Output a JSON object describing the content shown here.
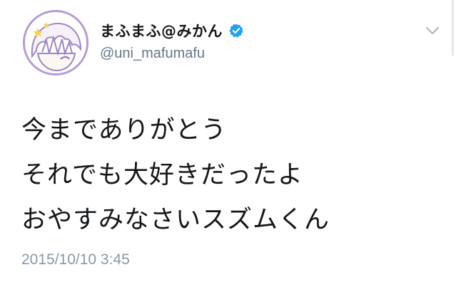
{
  "tweet": {
    "display_name": "まふまふ@みかん",
    "handle": "@uni_mafumafu",
    "verified": true,
    "body_lines": [
      "今までありがとう",
      "それでも大好きだったよ",
      "おやすみなさいスズムくん"
    ],
    "timestamp": "2015/10/10 3:45"
  },
  "icons": {
    "avatar": "avatar-illustration",
    "verified": "verified-badge-icon",
    "menu": "chevron-down-icon"
  },
  "colors": {
    "verified_blue": "#1da1f2",
    "avatar_ring": "#b59ad6",
    "handle_gray": "#657786",
    "timestamp_gray": "#8899a6",
    "text": "#14171a"
  }
}
